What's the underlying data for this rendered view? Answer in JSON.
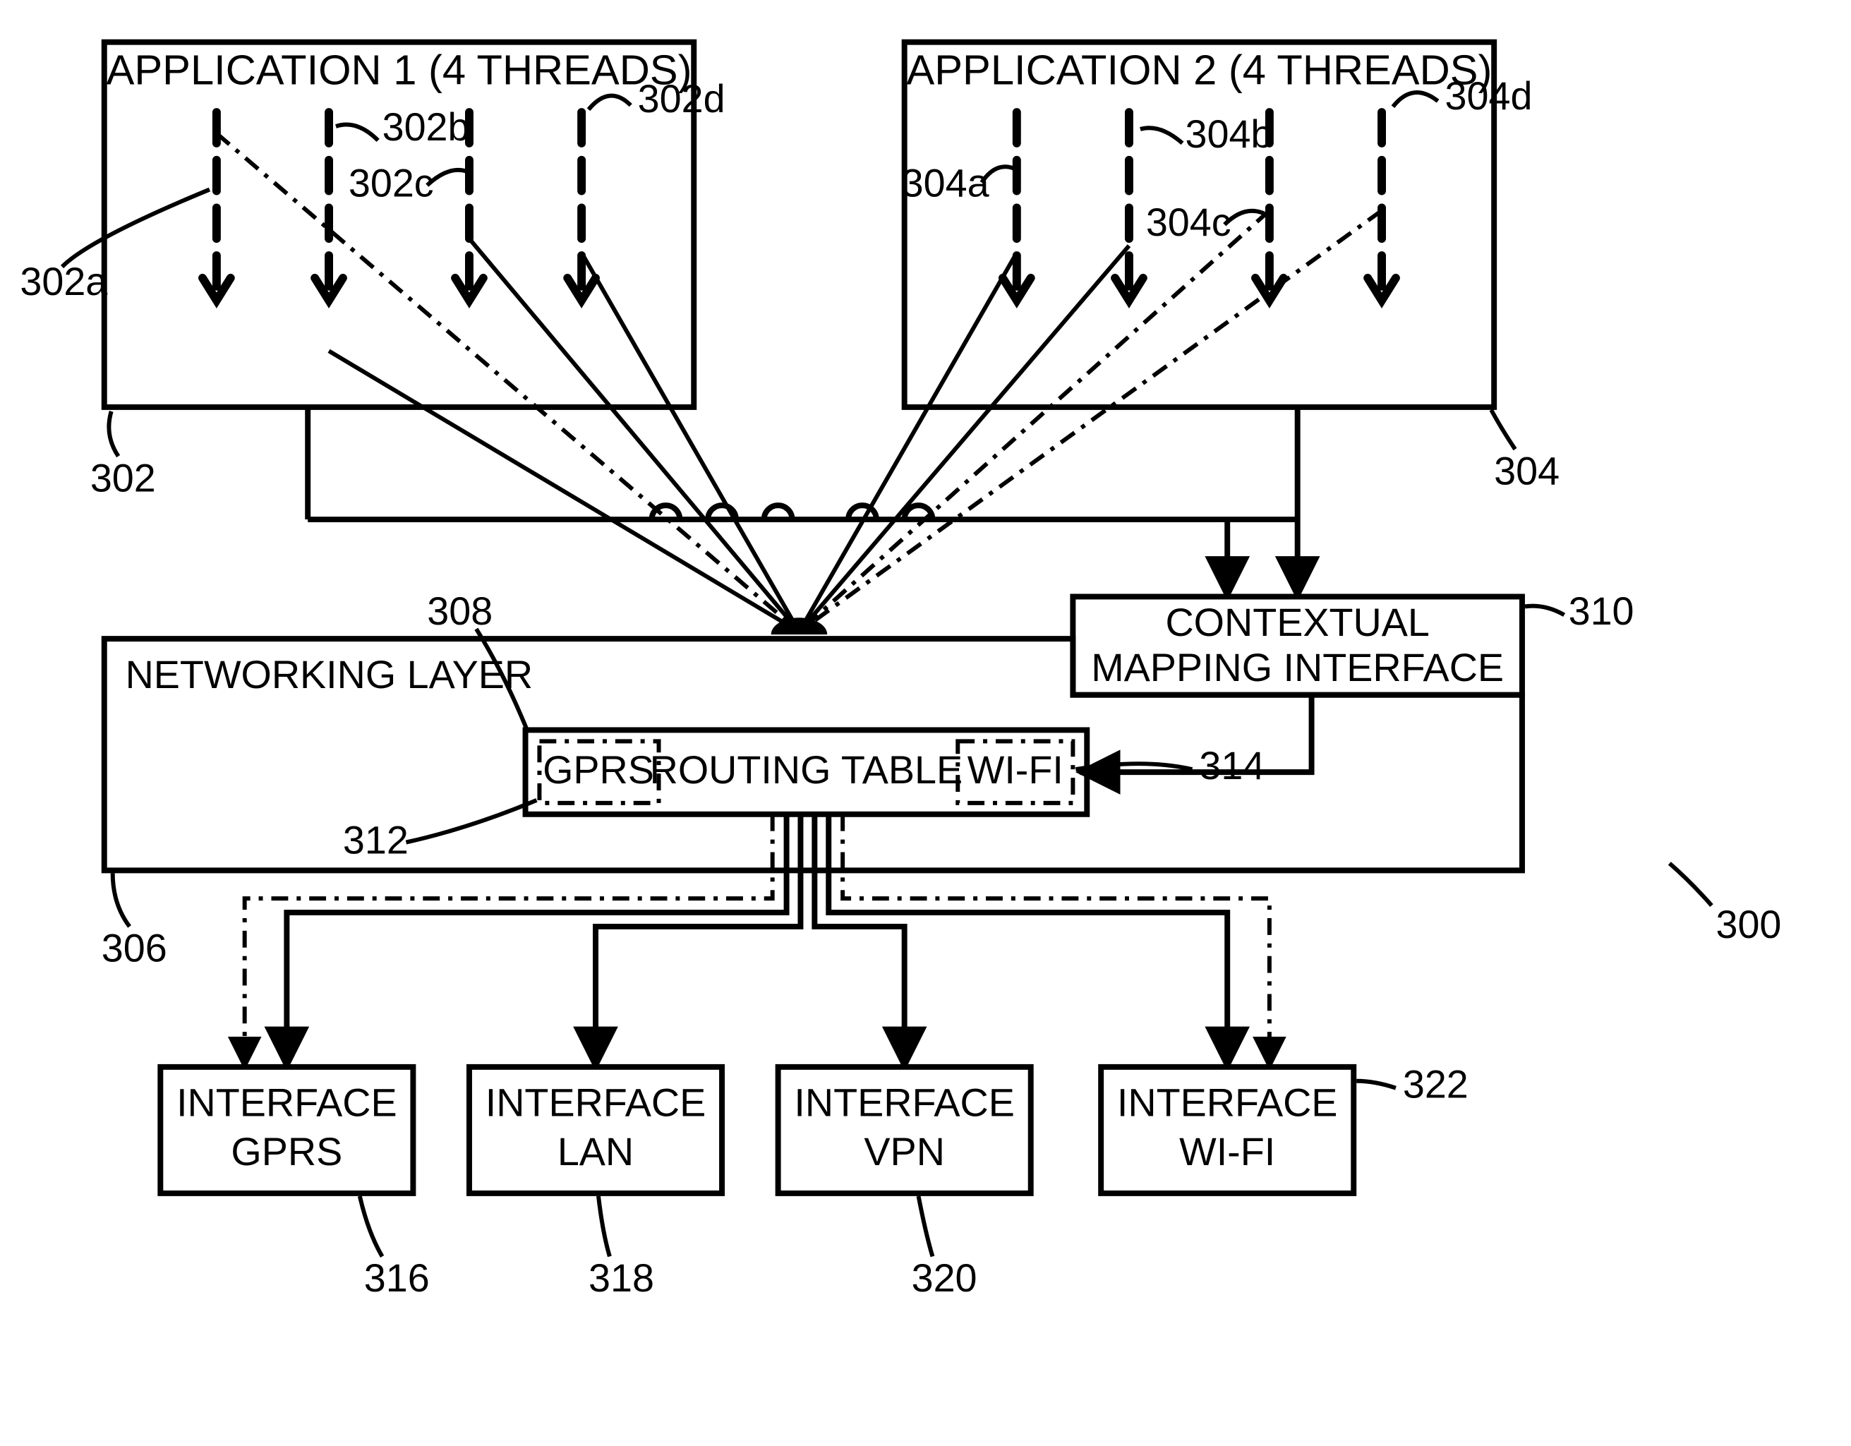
{
  "app1": {
    "title": "APPLICATION 1 (4 THREADS)"
  },
  "app2": {
    "title": "APPLICATION 2 (4 THREADS)"
  },
  "net": {
    "title": "NETWORKING LAYER",
    "routing": "ROUTING TABLE",
    "gprs": "GPRS",
    "wifi": "WI-FI"
  },
  "cmi": {
    "l1": "CONTEXTUAL",
    "l2": "MAPPING INTERFACE"
  },
  "if": {
    "gprs1": "INTERFACE",
    "gprs2": "GPRS",
    "lan1": "INTERFACE",
    "lan2": "LAN",
    "vpn1": "INTERFACE",
    "vpn2": "VPN",
    "wifi1": "INTERFACE",
    "wifi2": "WI-FI"
  },
  "labels": {
    "n300": "300",
    "n302": "302",
    "n302a": "302a",
    "n302b": "302b",
    "n302c": "302c",
    "n302d": "302d",
    "n304": "304",
    "n304a": "304a",
    "n304b": "304b",
    "n304c": "304c",
    "n304d": "304d",
    "n306": "306",
    "n308": "308",
    "n310": "310",
    "n312": "312",
    "n314": "314",
    "n316": "316",
    "n318": "318",
    "n320": "320",
    "n322": "322"
  }
}
